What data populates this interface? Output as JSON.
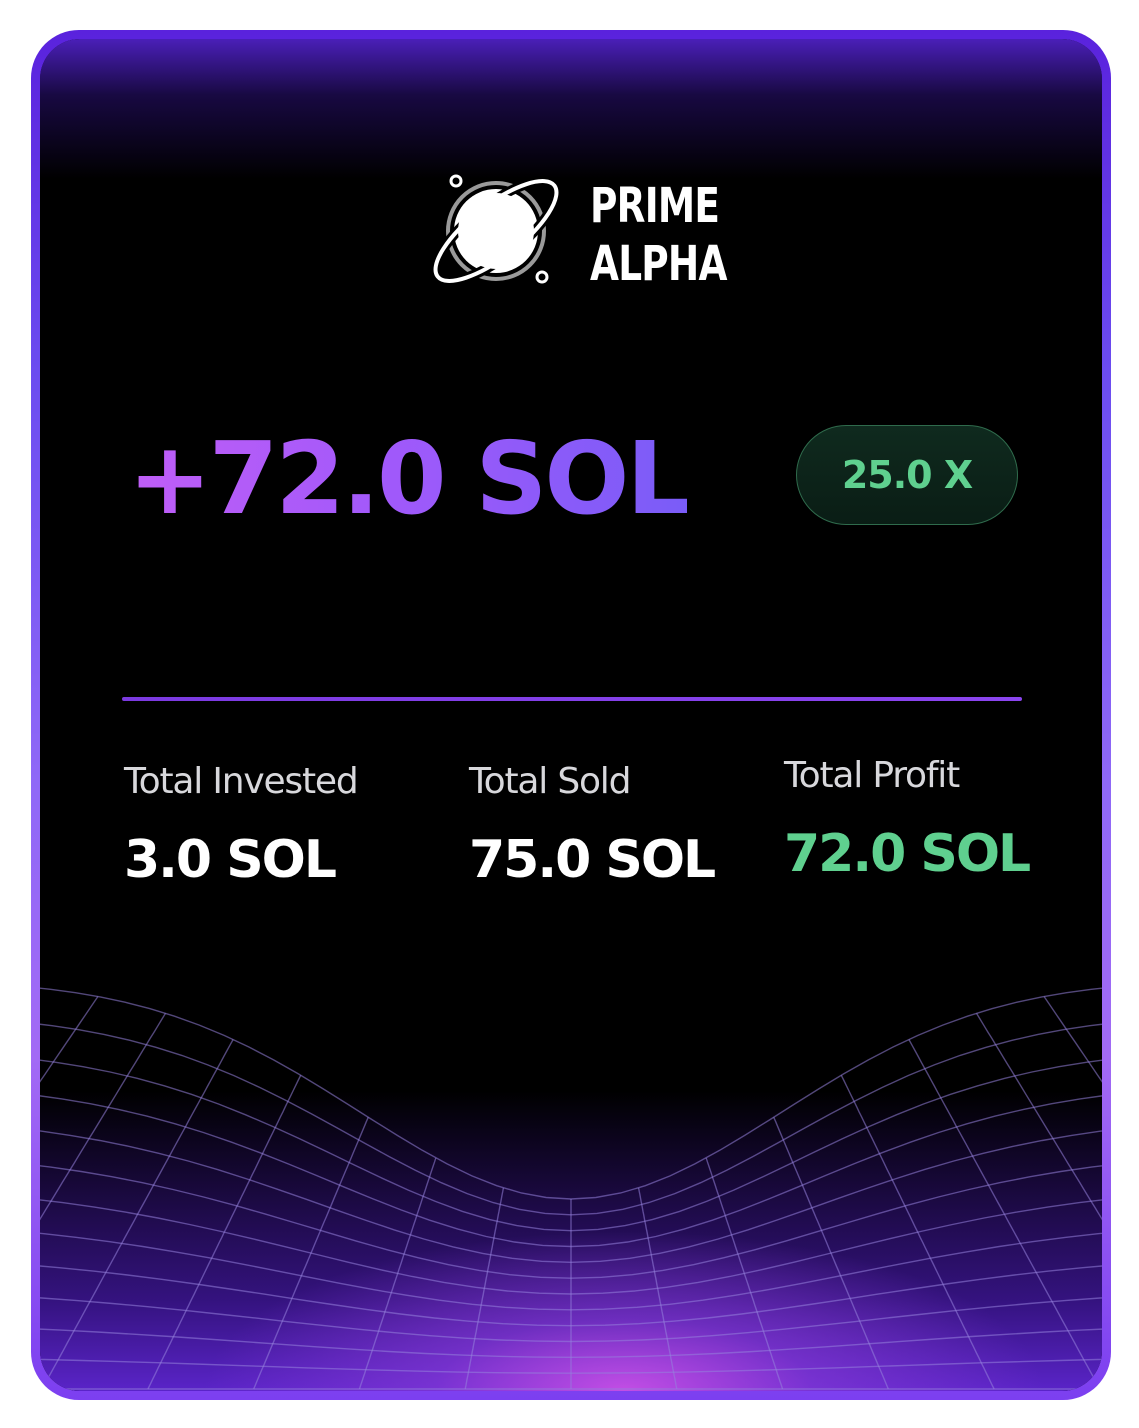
{
  "brand": {
    "name_line1": "PRIME",
    "name_line2": "ALPHA",
    "logo_icon": "planet-ring-icon"
  },
  "headline": {
    "amount": "+72.0 SOL",
    "multiplier": "25.0 X"
  },
  "stats": [
    {
      "label": "Total Invested",
      "value": "3.0 SOL"
    },
    {
      "label": "Total Sold",
      "value": "75.0 SOL"
    },
    {
      "label": "Total Profit",
      "value": "72.0 SOL"
    }
  ],
  "colors": {
    "accent_purple": "#a259fa",
    "profit_green": "#5fd08f",
    "frame_purple": "#6b4cf0"
  }
}
